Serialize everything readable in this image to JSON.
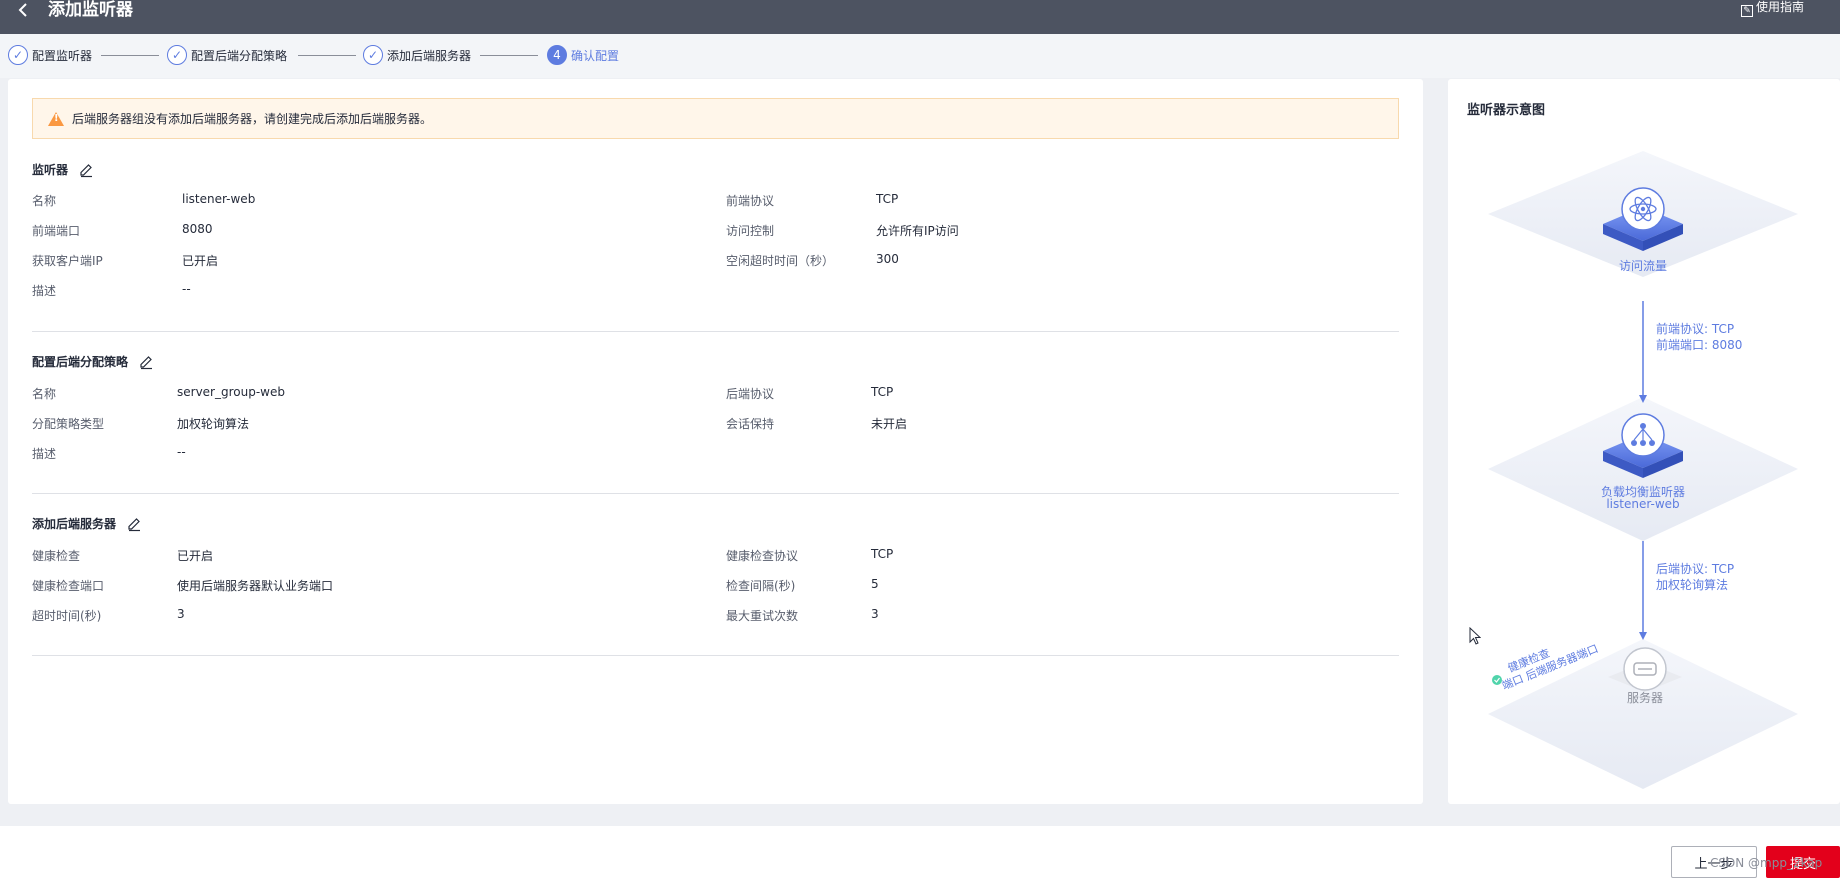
{
  "header": {
    "back_icon": "chevron-left-icon",
    "title": "添加监听器",
    "guide": "使用指南"
  },
  "steps": [
    {
      "label": "配置监听器",
      "status": "done"
    },
    {
      "label": "配置后端分配策略",
      "status": "done"
    },
    {
      "label": "添加后端服务器",
      "status": "done"
    },
    {
      "label": "确认配置",
      "status": "active",
      "number": "4"
    }
  ],
  "warning": "后端服务器组没有添加后端服务器，请创建完成后添加后端服务器。",
  "listener": {
    "title": "监听器",
    "rows": [
      {
        "label": "名称",
        "value": "listener-web"
      },
      {
        "label": "前端协议",
        "value": "TCP"
      },
      {
        "label": "前端端口",
        "value": "8080"
      },
      {
        "label": "访问控制",
        "value": "允许所有IP访问"
      },
      {
        "label": "获取客户端IP",
        "value": "已开启"
      },
      {
        "label": "空闲超时时间（秒）",
        "value": "300"
      },
      {
        "label": "描述",
        "value": "--"
      }
    ]
  },
  "strategy": {
    "title": "配置后端分配策略",
    "rows": [
      {
        "label": "名称",
        "value": "server_group-web"
      },
      {
        "label": "后端协议",
        "value": "TCP"
      },
      {
        "label": "分配策略类型",
        "value": "加权轮询算法"
      },
      {
        "label": "会话保持",
        "value": "未开启"
      },
      {
        "label": "描述",
        "value": "--"
      }
    ]
  },
  "backend": {
    "title": "添加后端服务器",
    "rows": [
      {
        "label": "健康检查",
        "value": "已开启"
      },
      {
        "label": "健康检查协议",
        "value": "TCP"
      },
      {
        "label": "健康检查端口",
        "value": "使用后端服务器默认业务端口"
      },
      {
        "label": "检查间隔(秒)",
        "value": "5"
      },
      {
        "label": "超时时间(秒)",
        "value": "3"
      },
      {
        "label": "最大重试次数",
        "value": "3"
      }
    ]
  },
  "diagram": {
    "title": "监听器示意图",
    "traffic": "访问流量",
    "edge1": [
      "前端协议: TCP",
      "前端端口: 8080"
    ],
    "lb_label": "负载均衡监听器",
    "lb_name": "listener-web",
    "edge2": [
      "后端协议: TCP",
      "加权轮询算法"
    ],
    "server": "服务器",
    "health": [
      "健康检查",
      "端口 后端服务器端口"
    ]
  },
  "footer": {
    "prev": "上一步",
    "submit": "提交",
    "watermark": "CSDN @mpp_2kap"
  },
  "colors": {
    "primary": "#5e7ce0",
    "submit": "#e3001b",
    "warning": "#fa9841",
    "topbar": "#4d5361"
  }
}
